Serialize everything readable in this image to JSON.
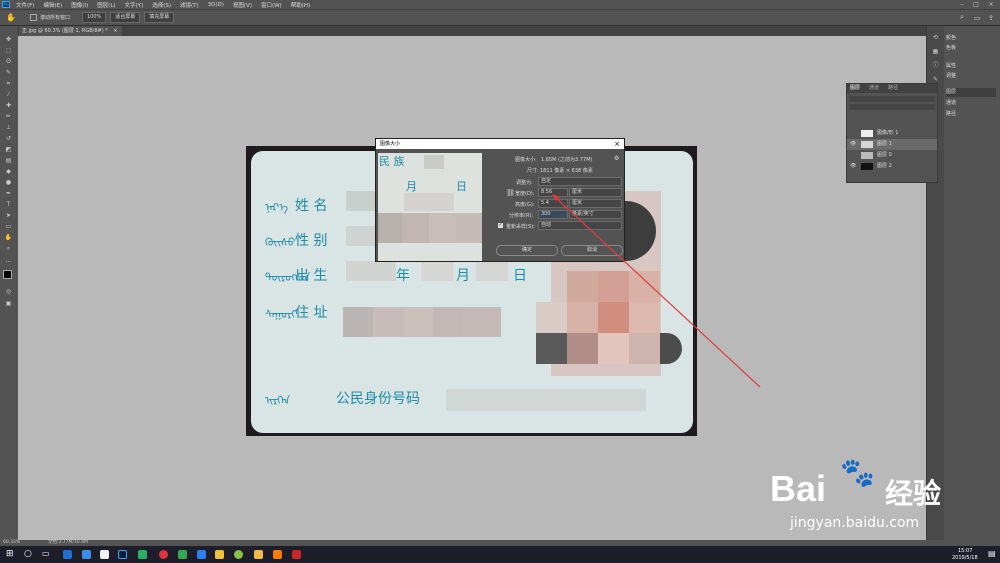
{
  "menubar": {
    "items": [
      "文件(F)",
      "编辑(E)",
      "图像(I)",
      "图层(L)",
      "文字(Y)",
      "选择(S)",
      "滤镜(T)",
      "3D(D)",
      "视图(V)",
      "窗口(W)",
      "帮助(H)"
    ]
  },
  "options": {
    "scroll_all_label": "滚动所有窗口",
    "zoom": "100%",
    "fit_screen": "适合屏幕",
    "fill_screen": "填充屏幕"
  },
  "doc_tab": {
    "title": "正.jpg @ 60.3% (图层 1, RGB/8#) *",
    "close": "×"
  },
  "card": {
    "labels": {
      "name": "姓  名",
      "gender": "性  别",
      "birth": "出  生",
      "year": "年",
      "month": "月",
      "day": "日",
      "address": "住  址",
      "idnum": "公民身份号码"
    }
  },
  "dialog": {
    "title": "图像大小",
    "close": "×",
    "preview": {
      "ethnic": "民  族",
      "month": "月",
      "day": "日"
    },
    "image_size_label": "图像大小:",
    "image_size_value": "1.85M (之前为3.77M)",
    "dimensions_label": "尺寸:",
    "dimensions_value": "1811 像素 × 638 像素",
    "fit_label": "调整为:",
    "fit_value": "自定",
    "width_label": "宽度(D):",
    "width_value": "8.56",
    "width_unit": "厘米",
    "height_label": "高度(G):",
    "height_value": "5.4",
    "height_unit": "厘米",
    "resolution_label": "分辨率(R):",
    "resolution_value": "300",
    "resolution_unit": "像素/英寸",
    "resample_label": "重新采样(S):",
    "resample_value": "自动",
    "ok": "确定",
    "cancel": "取消"
  },
  "right_panel": {
    "items": [
      "颜色",
      "色板",
      "属性",
      "调整",
      "图层",
      "通道",
      "路径"
    ]
  },
  "layers_panel": {
    "tabs": [
      "图层",
      "通道",
      "路径"
    ],
    "layers": [
      "图像/形 1",
      "图层 1",
      "图层 0",
      "图层 2"
    ]
  },
  "status": {
    "zoom": "60.33%",
    "doc": "文档:3.77M/10.4M"
  },
  "taskbar": {
    "time": "15:07",
    "date": "2019/5/18"
  },
  "watermark": {
    "text1": "Bai",
    "text2": "经验",
    "url": "jingyan.baidu.com"
  },
  "colors": {
    "accent": "#31a8ff",
    "bg": "#535353",
    "canvas": "#b9b9b9",
    "arrow": "#e03a3a"
  }
}
